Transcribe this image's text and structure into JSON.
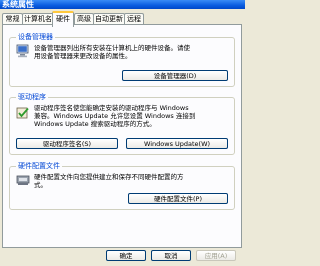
{
  "window": {
    "title": "系统属性"
  },
  "tabs": [
    {
      "label": "常规"
    },
    {
      "label": "计算机名"
    },
    {
      "label": "硬件"
    },
    {
      "label": "高级"
    },
    {
      "label": "自动更新"
    },
    {
      "label": "远程"
    }
  ],
  "active_tab": "硬件",
  "device_manager": {
    "title": "设备管理器",
    "line1": "设备管理器列出所有安装在计算机上的硬件设备。请使",
    "line2": "用设备管理器来更改设备的属性。",
    "button": "设备管理器(D)"
  },
  "driver": {
    "title": "驱动程序",
    "line1": "驱动程序签名使您能确定安装的驱动程序与 Windows",
    "line2": "兼容。Windows Update 允许您设置 Windows 连接到",
    "line3": "Windows Update 搜索驱动程序的方式。",
    "button_signing": "驱动程序签名(S)",
    "button_update": "Windows Update(W)"
  },
  "profiles": {
    "title": "硬件配置文件",
    "line1": "硬件配置文件向您提供建立和保存不同硬件配置的方",
    "line2": "式。",
    "button": "硬件配置文件(P)"
  },
  "footer": {
    "ok": "确定",
    "cancel": "取消",
    "apply": "应用(A)"
  }
}
